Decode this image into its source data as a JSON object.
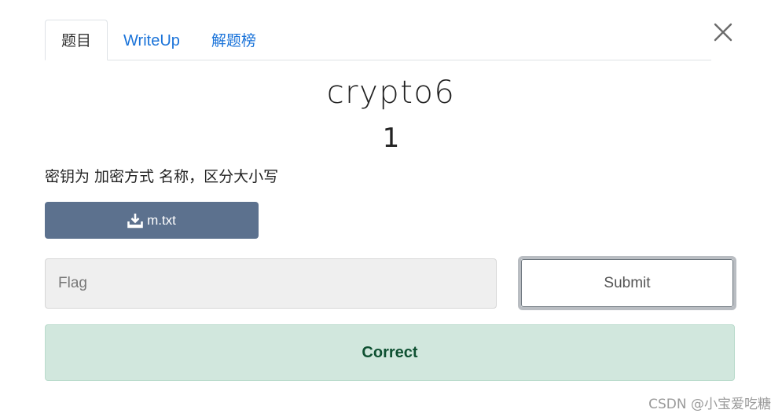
{
  "tabs": [
    {
      "label": "题目",
      "active": true
    },
    {
      "label": "WriteUp",
      "active": false
    },
    {
      "label": "解题榜",
      "active": false
    }
  ],
  "challenge": {
    "name": "crypto6",
    "points": "1",
    "description": "密钥为 加密方式 名称，区分大小写"
  },
  "file": {
    "label": "m.txt",
    "icon": "download-icon"
  },
  "flag_input": {
    "value": "",
    "placeholder": "Flag"
  },
  "submit": {
    "label": "Submit"
  },
  "result": {
    "message": "Correct",
    "status_color": "#d1e7dd"
  },
  "watermark": "CSDN @小宝爱吃糖",
  "colors": {
    "tab_link": "#1a73d9",
    "file_button": "#5c718e",
    "success_text": "#0f5132"
  }
}
